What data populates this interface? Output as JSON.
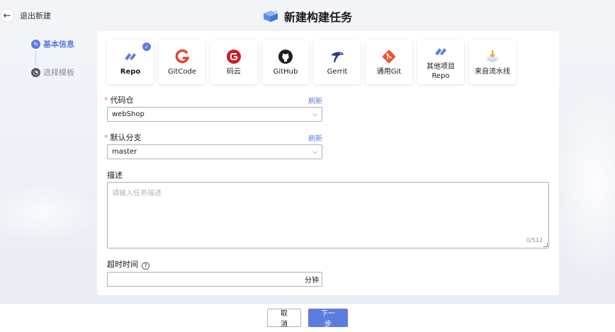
{
  "header": {
    "back_label": "退出新建",
    "title": "新建构建任务"
  },
  "steps": [
    {
      "label": "基本信息",
      "state": "active"
    },
    {
      "label": "选择模板",
      "state": "inactive"
    }
  ],
  "repos": [
    {
      "label": "Repo",
      "icon": "repo-icon",
      "selected": true
    },
    {
      "label": "GitCode",
      "icon": "gitcode-icon",
      "selected": false
    },
    {
      "label": "码云",
      "icon": "gitee-icon",
      "selected": false
    },
    {
      "label": "GitHub",
      "icon": "github-icon",
      "selected": false
    },
    {
      "label": "Gerrit",
      "icon": "gerrit-icon",
      "selected": false
    },
    {
      "label": "通用Git",
      "icon": "git-icon",
      "selected": false
    },
    {
      "label": "其他项目Repo",
      "icon": "other-repo-icon",
      "selected": false
    },
    {
      "label": "来自流水线",
      "icon": "pipeline-icon",
      "selected": false
    }
  ],
  "form": {
    "repo_label": "代码仓",
    "repo_value": "webShop",
    "branch_label": "默认分支",
    "branch_value": "master",
    "refresh_label": "刷新",
    "desc_label": "描述",
    "desc_placeholder": "请输入任务描述",
    "desc_counter": "0/512",
    "timeout_label": "超时时间",
    "timeout_unit": "分钟",
    "required_mark": "*"
  },
  "footer": {
    "cancel_label": "取消",
    "next_label": "下一步"
  },
  "colors": {
    "accent": "#5e7ce0",
    "required": "#f66f6a"
  }
}
